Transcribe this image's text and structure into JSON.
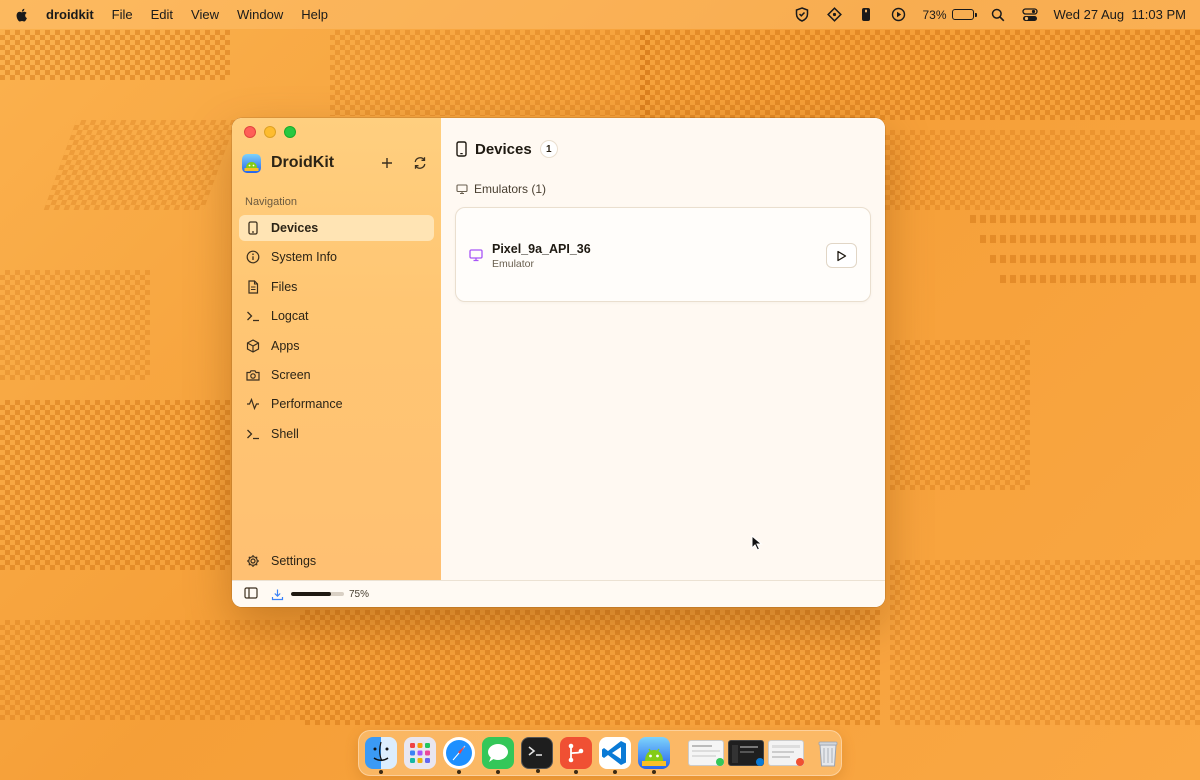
{
  "menubar": {
    "app_name": "droidkit",
    "menus": [
      "File",
      "Edit",
      "View",
      "Window",
      "Help"
    ],
    "battery_percent": "73%",
    "battery_level": 0.73,
    "datetime": "Wed 27 Aug  11:03 PM"
  },
  "sidebar": {
    "app_title": "DroidKit",
    "nav_heading": "Navigation",
    "items": [
      {
        "label": "Devices",
        "icon": "smartphone-icon",
        "active": true
      },
      {
        "label": "System Info",
        "icon": "info-icon"
      },
      {
        "label": "Files",
        "icon": "file-icon"
      },
      {
        "label": "Logcat",
        "icon": "terminal-icon"
      },
      {
        "label": "Apps",
        "icon": "package-icon"
      },
      {
        "label": "Screen",
        "icon": "camera-icon"
      },
      {
        "label": "Performance",
        "icon": "activity-icon"
      },
      {
        "label": "Shell",
        "icon": "terminal-icon"
      }
    ],
    "settings_label": "Settings"
  },
  "main": {
    "title": "Devices",
    "count": "1",
    "section_title": "Emulators (1)",
    "device": {
      "name": "Pixel_9a_API_36",
      "type": "Emulator"
    }
  },
  "bottom_bar": {
    "progress_label": "75%",
    "progress_value": 0.75
  },
  "colors": {
    "accent_purple": "#a855f7",
    "download_blue": "#3b82f6",
    "sidebar_bg": "#ffc673",
    "desktop_bg": "#f6a23a"
  }
}
